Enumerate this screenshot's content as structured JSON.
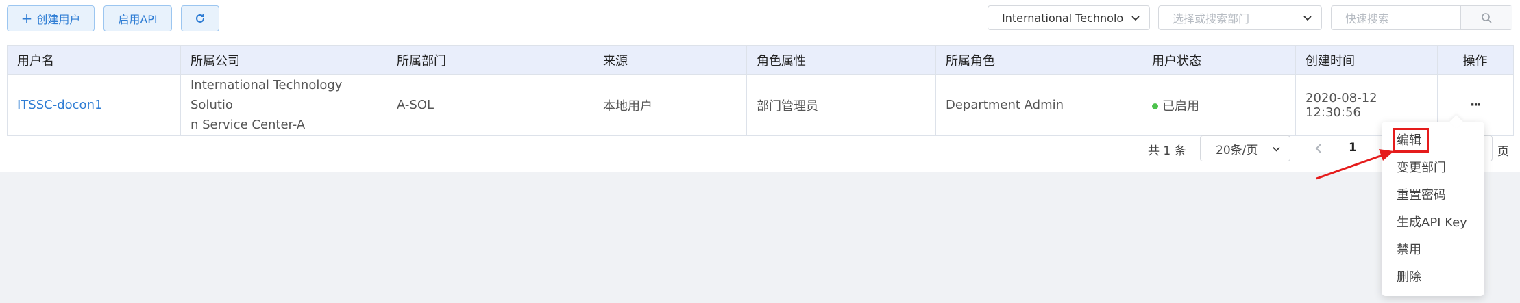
{
  "toolbar": {
    "create_user_label": "创建用户",
    "enable_api_label": "启用API",
    "company_select_value": "International Technolo",
    "department_placeholder": "选择或搜索部门",
    "search_placeholder": "快速搜索"
  },
  "table": {
    "columns": [
      "用户名",
      "所属公司",
      "所属部门",
      "来源",
      "角色属性",
      "所属角色",
      "用户状态",
      "创建时间",
      "操作"
    ],
    "rows": [
      {
        "username": "ITSSC-docon1",
        "company_line1": "International Technology Solutio",
        "company_line2": "n Service Center-A",
        "department": "A-SOL",
        "source": "本地用户",
        "role_attr": "部门管理员",
        "role": "Department Admin",
        "status": "已启用",
        "created": "2020-08-12 12:30:56",
        "ops": "···"
      }
    ]
  },
  "pagination": {
    "total": "共 1 条",
    "page_size": "20条/页",
    "current_page": "1",
    "suffix": "页"
  },
  "menu": {
    "items": [
      "编辑",
      "变更部门",
      "重置密码",
      "生成API Key",
      "禁用",
      "删除"
    ]
  },
  "colors": {
    "accent": "#2f7dd4",
    "highlight": "#e51c1c",
    "status_enabled": "#4cc24c",
    "header_bg": "#e9eefb"
  }
}
